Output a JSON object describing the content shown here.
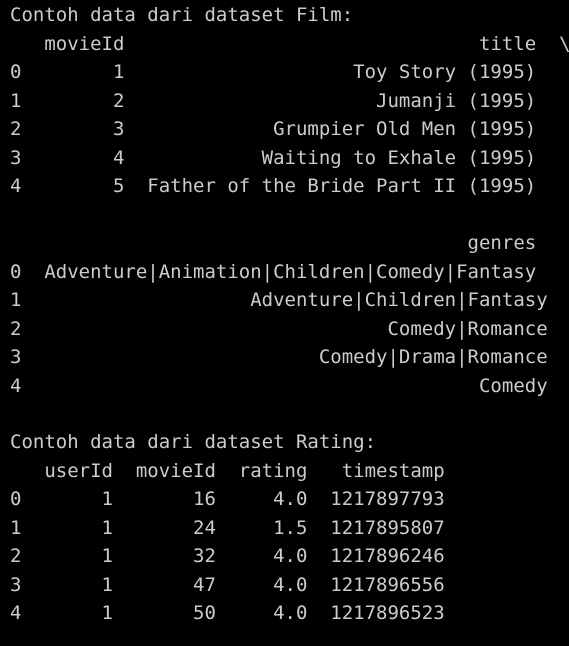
{
  "terminal": {
    "lines": [
      "Contoh data dari dataset Film:",
      "   movieId                               title  \\",
      "0        1                    Toy Story (1995)   ",
      "1        2                      Jumanji (1995)   ",
      "2        3             Grumpier Old Men (1995)   ",
      "3        4            Waiting to Exhale (1995)   ",
      "4        5  Father of the Bride Part II (1995)   ",
      "",
      "                                        genres  ",
      "0  Adventure|Animation|Children|Comedy|Fantasy  ",
      "1                    Adventure|Children|Fantasy  ",
      "2                                Comedy|Romance  ",
      "3                          Comedy|Drama|Romance  ",
      "4                                        Comedy  ",
      "",
      "Contoh data dari dataset Rating:",
      "   userId  movieId  rating   timestamp",
      "0       1       16     4.0  1217897793",
      "1       1       24     1.5  1217895807",
      "2       1       32     4.0  1217896246",
      "3       1       47     4.0  1217896556",
      "4       1       50     4.0  1217896523"
    ]
  }
}
